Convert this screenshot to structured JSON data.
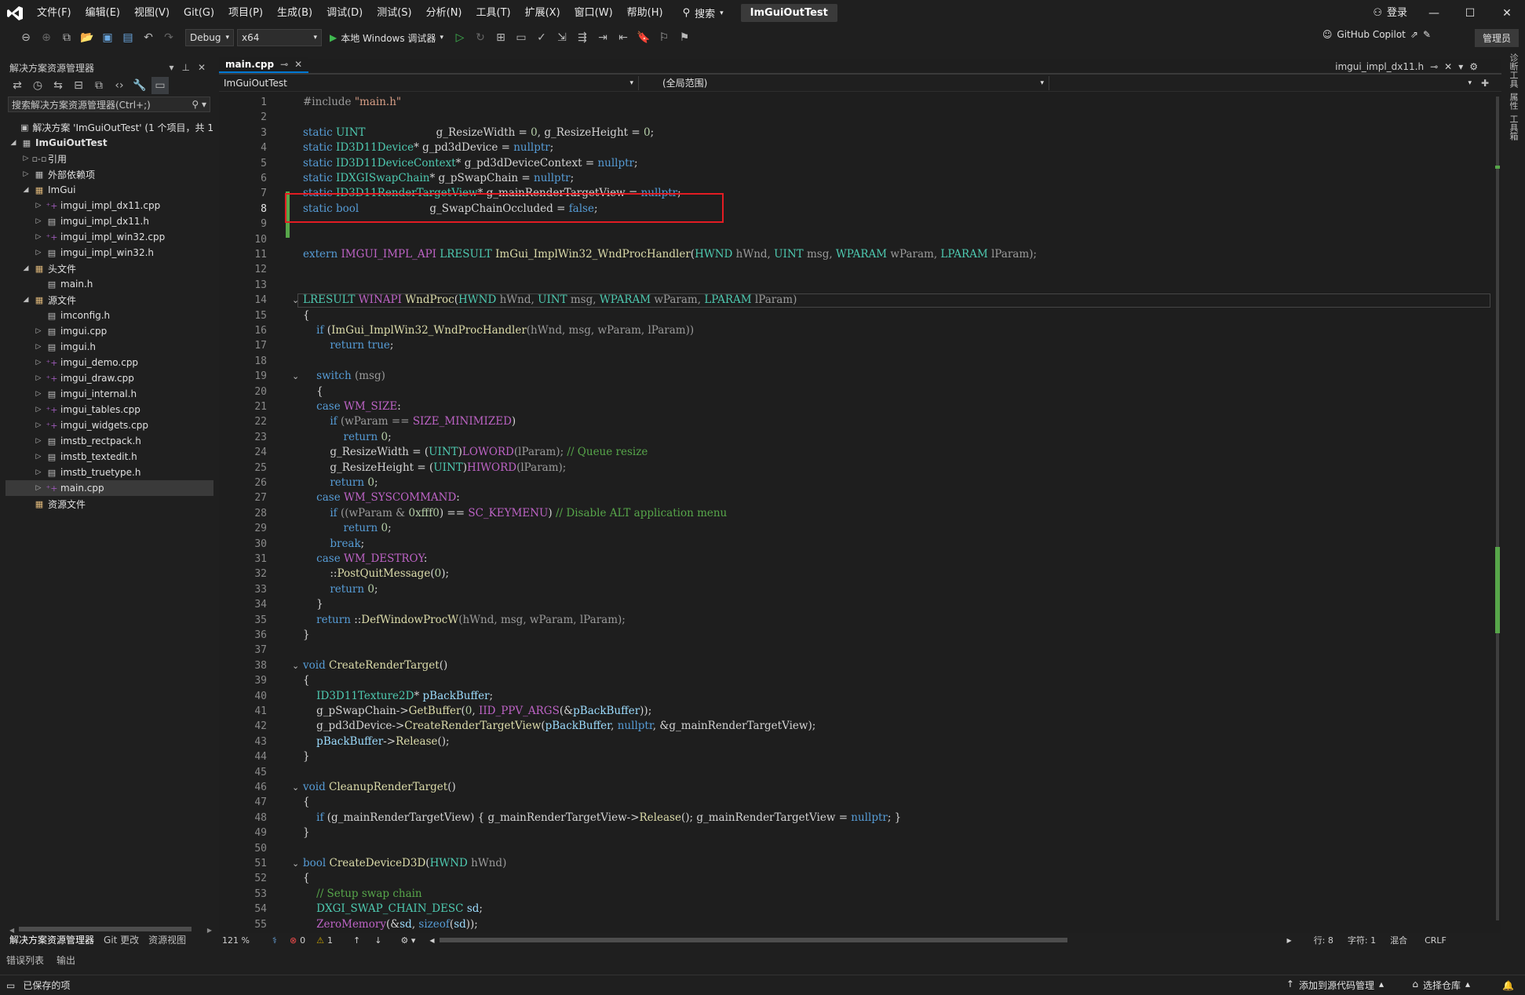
{
  "menubar": {
    "items": [
      "文件(F)",
      "编辑(E)",
      "视图(V)",
      "Git(G)",
      "项目(P)",
      "生成(B)",
      "调试(D)",
      "测试(S)",
      "分析(N)",
      "工具(T)",
      "扩展(X)",
      "窗口(W)",
      "帮助(H)"
    ],
    "search": "搜索",
    "solution_title": "ImGuiOutTest",
    "login": "登录"
  },
  "toolbar": {
    "config": "Debug",
    "platform": "x64",
    "run_label": "本地 Windows 调试器",
    "copilot": "GitHub Copilot",
    "admin": "管理员"
  },
  "solution_explorer": {
    "title": "解决方案资源管理器",
    "search_placeholder": "搜索解决方案资源管理器(Ctrl+;)",
    "tree": [
      {
        "label": "解决方案 'ImGuiOutTest' (1 个项目，共 1",
        "indent": 0,
        "icon": "solution-icon",
        "twisty": ""
      },
      {
        "label": "ImGuiOutTest",
        "indent": 0,
        "icon": "project-icon",
        "twisty": "◢",
        "bold": true
      },
      {
        "label": "引用",
        "indent": 1,
        "icon": "reference-icon",
        "twisty": "▷"
      },
      {
        "label": "外部依赖项",
        "indent": 1,
        "icon": "dependency-icon",
        "twisty": "▷"
      },
      {
        "label": "ImGui",
        "indent": 1,
        "icon": "folder-icon",
        "twisty": "◢"
      },
      {
        "label": "imgui_impl_dx11.cpp",
        "indent": 2,
        "icon": "cpp-file-icon",
        "twisty": "▷"
      },
      {
        "label": "imgui_impl_dx11.h",
        "indent": 2,
        "icon": "header-file-icon",
        "twisty": "▷"
      },
      {
        "label": "imgui_impl_win32.cpp",
        "indent": 2,
        "icon": "cpp-file-icon",
        "twisty": "▷"
      },
      {
        "label": "imgui_impl_win32.h",
        "indent": 2,
        "icon": "header-file-icon",
        "twisty": "▷"
      },
      {
        "label": "头文件",
        "indent": 1,
        "icon": "folder-icon",
        "twisty": "◢"
      },
      {
        "label": "main.h",
        "indent": 2,
        "icon": "header-file-icon",
        "twisty": ""
      },
      {
        "label": "源文件",
        "indent": 1,
        "icon": "folder-icon",
        "twisty": "◢"
      },
      {
        "label": "imconfig.h",
        "indent": 2,
        "icon": "header-file-icon",
        "twisty": ""
      },
      {
        "label": "imgui.cpp",
        "indent": 2,
        "icon": "header-file-icon",
        "twisty": "▷"
      },
      {
        "label": "imgui.h",
        "indent": 2,
        "icon": "header-file-icon",
        "twisty": "▷"
      },
      {
        "label": "imgui_demo.cpp",
        "indent": 2,
        "icon": "cpp-file-icon",
        "twisty": "▷"
      },
      {
        "label": "imgui_draw.cpp",
        "indent": 2,
        "icon": "cpp-file-icon",
        "twisty": "▷"
      },
      {
        "label": "imgui_internal.h",
        "indent": 2,
        "icon": "header-file-icon",
        "twisty": "▷"
      },
      {
        "label": "imgui_tables.cpp",
        "indent": 2,
        "icon": "cpp-file-icon",
        "twisty": "▷"
      },
      {
        "label": "imgui_widgets.cpp",
        "indent": 2,
        "icon": "cpp-file-icon",
        "twisty": "▷"
      },
      {
        "label": "imstb_rectpack.h",
        "indent": 2,
        "icon": "header-file-icon",
        "twisty": "▷"
      },
      {
        "label": "imstb_textedit.h",
        "indent": 2,
        "icon": "header-file-icon",
        "twisty": "▷"
      },
      {
        "label": "imstb_truetype.h",
        "indent": 2,
        "icon": "header-file-icon",
        "twisty": "▷"
      },
      {
        "label": "main.cpp",
        "indent": 2,
        "icon": "cpp-file-icon",
        "twisty": "▷",
        "selected": true
      },
      {
        "label": "资源文件",
        "indent": 1,
        "icon": "folder-icon",
        "twisty": ""
      }
    ],
    "bottom_tabs": [
      "解决方案资源管理器",
      "Git 更改",
      "资源视图"
    ]
  },
  "bottom_panel_tabs": [
    "错误列表",
    "输出"
  ],
  "editor": {
    "active_tab": "main.cpp",
    "right_tab": "imgui_impl_dx11.h",
    "nav_project": "ImGuiOutTest",
    "nav_scope": "(全局范围)",
    "zoom": "121 %",
    "errors": "0",
    "warnings": "1",
    "position_line": "行: 8",
    "position_char": "字符: 1",
    "indent_mode": "混合",
    "line_ending": "CRLF"
  },
  "code_lines": [
    [
      {
        "t": "#include ",
        "c": "pr"
      },
      {
        "t": "\"main.h\"",
        "c": "st"
      }
    ],
    [],
    [
      {
        "t": "static ",
        "c": "kw"
      },
      {
        "t": "UINT",
        "c": "ty"
      },
      {
        "t": "                     g_ResizeWidth = ",
        "c": "pl"
      },
      {
        "t": "0",
        "c": "nm"
      },
      {
        "t": ", g_ResizeHeight = ",
        "c": "pl"
      },
      {
        "t": "0",
        "c": "nm"
      },
      {
        "t": ";",
        "c": "pl"
      }
    ],
    [
      {
        "t": "static ",
        "c": "kw"
      },
      {
        "t": "ID3D11Device",
        "c": "ty"
      },
      {
        "t": "* g_pd3dDevice = ",
        "c": "pl"
      },
      {
        "t": "nullptr",
        "c": "kw"
      },
      {
        "t": ";",
        "c": "pl"
      }
    ],
    [
      {
        "t": "static ",
        "c": "kw"
      },
      {
        "t": "ID3D11DeviceContext",
        "c": "ty"
      },
      {
        "t": "* g_pd3dDeviceContext = ",
        "c": "pl"
      },
      {
        "t": "nullptr",
        "c": "kw"
      },
      {
        "t": ";",
        "c": "pl"
      }
    ],
    [
      {
        "t": "static ",
        "c": "kw"
      },
      {
        "t": "IDXGISwapChain",
        "c": "ty"
      },
      {
        "t": "* g_pSwapChain = ",
        "c": "pl"
      },
      {
        "t": "nullptr",
        "c": "kw"
      },
      {
        "t": ";",
        "c": "pl"
      }
    ],
    [
      {
        "t": "static ",
        "c": "kw"
      },
      {
        "t": "ID3D11RenderTargetView",
        "c": "ty"
      },
      {
        "t": "* g_mainRenderTargetView = ",
        "c": "pl"
      },
      {
        "t": "nullptr",
        "c": "kw"
      },
      {
        "t": ";",
        "c": "pl"
      }
    ],
    [
      {
        "t": "static ",
        "c": "kw"
      },
      {
        "t": "bool",
        "c": "kw"
      },
      {
        "t": "                     g_SwapChainOccluded = ",
        "c": "pl"
      },
      {
        "t": "false",
        "c": "kw"
      },
      {
        "t": ";",
        "c": "pl"
      }
    ],
    [],
    [],
    [
      {
        "t": "extern ",
        "c": "kw"
      },
      {
        "t": "IMGUI_IMPL_API ",
        "c": "mc"
      },
      {
        "t": "LRESULT ",
        "c": "ty"
      },
      {
        "t": "ImGui_ImplWin32_WndProcHandler",
        "c": "fn"
      },
      {
        "t": "(",
        "c": "pl"
      },
      {
        "t": "HWND",
        "c": "ty"
      },
      {
        "t": " hWnd, ",
        "c": "pr"
      },
      {
        "t": "UINT",
        "c": "ty"
      },
      {
        "t": " msg, ",
        "c": "pr"
      },
      {
        "t": "WPARAM",
        "c": "ty"
      },
      {
        "t": " wParam, ",
        "c": "pr"
      },
      {
        "t": "LPARAM",
        "c": "ty"
      },
      {
        "t": " lParam);",
        "c": "pr"
      }
    ],
    [],
    [],
    [
      {
        "t": "LRESULT ",
        "c": "ty"
      },
      {
        "t": "WINAPI ",
        "c": "mc"
      },
      {
        "t": "WndProc",
        "c": "fn"
      },
      {
        "t": "(",
        "c": "pl"
      },
      {
        "t": "HWND",
        "c": "ty"
      },
      {
        "t": " hWnd, ",
        "c": "pr"
      },
      {
        "t": "UINT",
        "c": "ty"
      },
      {
        "t": " msg, ",
        "c": "pr"
      },
      {
        "t": "WPARAM",
        "c": "ty"
      },
      {
        "t": " wParam, ",
        "c": "pr"
      },
      {
        "t": "LPARAM",
        "c": "ty"
      },
      {
        "t": " lParam)",
        "c": "pr"
      }
    ],
    [
      {
        "t": "{",
        "c": "pl"
      }
    ],
    [
      {
        "t": "    ",
        "c": "pl"
      },
      {
        "t": "if ",
        "c": "kw"
      },
      {
        "t": "(",
        "c": "pl"
      },
      {
        "t": "ImGui_ImplWin32_WndProcHandler",
        "c": "fn"
      },
      {
        "t": "(hWnd, msg, wParam, lParam))",
        "c": "pr"
      }
    ],
    [
      {
        "t": "        ",
        "c": "pl"
      },
      {
        "t": "return ",
        "c": "kw"
      },
      {
        "t": "true",
        "c": "kw"
      },
      {
        "t": ";",
        "c": "pl"
      }
    ],
    [],
    [
      {
        "t": "    ",
        "c": "pl"
      },
      {
        "t": "switch ",
        "c": "kw"
      },
      {
        "t": "(msg)",
        "c": "pr"
      }
    ],
    [
      {
        "t": "    {",
        "c": "pl"
      }
    ],
    [
      {
        "t": "    ",
        "c": "pl"
      },
      {
        "t": "case ",
        "c": "kw"
      },
      {
        "t": "WM_SIZE",
        "c": "mc"
      },
      {
        "t": ":",
        "c": "pl"
      }
    ],
    [
      {
        "t": "        ",
        "c": "pl"
      },
      {
        "t": "if ",
        "c": "kw"
      },
      {
        "t": "(wParam == ",
        "c": "pr"
      },
      {
        "t": "SIZE_MINIMIZED",
        "c": "mc"
      },
      {
        "t": ")",
        "c": "pl"
      }
    ],
    [
      {
        "t": "            ",
        "c": "pl"
      },
      {
        "t": "return ",
        "c": "kw"
      },
      {
        "t": "0",
        "c": "nm"
      },
      {
        "t": ";",
        "c": "pl"
      }
    ],
    [
      {
        "t": "        g_ResizeWidth = (",
        "c": "pl"
      },
      {
        "t": "UINT",
        "c": "ty"
      },
      {
        "t": ")",
        "c": "pl"
      },
      {
        "t": "LOWORD",
        "c": "mc"
      },
      {
        "t": "(lParam); ",
        "c": "pr"
      },
      {
        "t": "// Queue resize",
        "c": "cm"
      }
    ],
    [
      {
        "t": "        g_ResizeHeight = (",
        "c": "pl"
      },
      {
        "t": "UINT",
        "c": "ty"
      },
      {
        "t": ")",
        "c": "pl"
      },
      {
        "t": "HIWORD",
        "c": "mc"
      },
      {
        "t": "(lParam);",
        "c": "pr"
      }
    ],
    [
      {
        "t": "        ",
        "c": "pl"
      },
      {
        "t": "return ",
        "c": "kw"
      },
      {
        "t": "0",
        "c": "nm"
      },
      {
        "t": ";",
        "c": "pl"
      }
    ],
    [
      {
        "t": "    ",
        "c": "pl"
      },
      {
        "t": "case ",
        "c": "kw"
      },
      {
        "t": "WM_SYSCOMMAND",
        "c": "mc"
      },
      {
        "t": ":",
        "c": "pl"
      }
    ],
    [
      {
        "t": "        ",
        "c": "pl"
      },
      {
        "t": "if ",
        "c": "kw"
      },
      {
        "t": "((wParam & ",
        "c": "pr"
      },
      {
        "t": "0xfff0",
        "c": "nm"
      },
      {
        "t": ") == ",
        "c": "pl"
      },
      {
        "t": "SC_KEYMENU",
        "c": "mc"
      },
      {
        "t": ") ",
        "c": "pl"
      },
      {
        "t": "// Disable ALT application menu",
        "c": "cm"
      }
    ],
    [
      {
        "t": "            ",
        "c": "pl"
      },
      {
        "t": "return ",
        "c": "kw"
      },
      {
        "t": "0",
        "c": "nm"
      },
      {
        "t": ";",
        "c": "pl"
      }
    ],
    [
      {
        "t": "        ",
        "c": "pl"
      },
      {
        "t": "break",
        "c": "kw"
      },
      {
        "t": ";",
        "c": "pl"
      }
    ],
    [
      {
        "t": "    ",
        "c": "pl"
      },
      {
        "t": "case ",
        "c": "kw"
      },
      {
        "t": "WM_DESTROY",
        "c": "mc"
      },
      {
        "t": ":",
        "c": "pl"
      }
    ],
    [
      {
        "t": "        ::",
        "c": "pl"
      },
      {
        "t": "PostQuitMessage",
        "c": "fn"
      },
      {
        "t": "(",
        "c": "pl"
      },
      {
        "t": "0",
        "c": "nm"
      },
      {
        "t": ");",
        "c": "pl"
      }
    ],
    [
      {
        "t": "        ",
        "c": "pl"
      },
      {
        "t": "return ",
        "c": "kw"
      },
      {
        "t": "0",
        "c": "nm"
      },
      {
        "t": ";",
        "c": "pl"
      }
    ],
    [
      {
        "t": "    }",
        "c": "pl"
      }
    ],
    [
      {
        "t": "    ",
        "c": "pl"
      },
      {
        "t": "return ",
        "c": "kw"
      },
      {
        "t": "::",
        "c": "pl"
      },
      {
        "t": "DefWindowProcW",
        "c": "fn"
      },
      {
        "t": "(hWnd, msg, wParam, lParam);",
        "c": "pr"
      }
    ],
    [
      {
        "t": "}",
        "c": "pl"
      }
    ],
    [],
    [
      {
        "t": "void ",
        "c": "kw"
      },
      {
        "t": "CreateRenderTarget",
        "c": "fn"
      },
      {
        "t": "()",
        "c": "pl"
      }
    ],
    [
      {
        "t": "{",
        "c": "pl"
      }
    ],
    [
      {
        "t": "    ",
        "c": "pl"
      },
      {
        "t": "ID3D11Texture2D",
        "c": "ty"
      },
      {
        "t": "* ",
        "c": "pl"
      },
      {
        "t": "pBackBuffer",
        "c": "var"
      },
      {
        "t": ";",
        "c": "pl"
      }
    ],
    [
      {
        "t": "    g_pSwapChain->",
        "c": "pl"
      },
      {
        "t": "GetBuffer",
        "c": "fn"
      },
      {
        "t": "(",
        "c": "pl"
      },
      {
        "t": "0",
        "c": "nm"
      },
      {
        "t": ", ",
        "c": "pl"
      },
      {
        "t": "IID_PPV_ARGS",
        "c": "mc"
      },
      {
        "t": "(&",
        "c": "pl"
      },
      {
        "t": "pBackBuffer",
        "c": "var"
      },
      {
        "t": "));",
        "c": "pl"
      }
    ],
    [
      {
        "t": "    g_pd3dDevice->",
        "c": "pl"
      },
      {
        "t": "CreateRenderTargetView",
        "c": "fn"
      },
      {
        "t": "(",
        "c": "pl"
      },
      {
        "t": "pBackBuffer",
        "c": "var"
      },
      {
        "t": ", ",
        "c": "pl"
      },
      {
        "t": "nullptr",
        "c": "kw"
      },
      {
        "t": ", &g_mainRenderTargetView);",
        "c": "pl"
      }
    ],
    [
      {
        "t": "    ",
        "c": "pl"
      },
      {
        "t": "pBackBuffer",
        "c": "var"
      },
      {
        "t": "->",
        "c": "pl"
      },
      {
        "t": "Release",
        "c": "fn"
      },
      {
        "t": "();",
        "c": "pl"
      }
    ],
    [
      {
        "t": "}",
        "c": "pl"
      }
    ],
    [],
    [
      {
        "t": "void ",
        "c": "kw"
      },
      {
        "t": "CleanupRenderTarget",
        "c": "fn"
      },
      {
        "t": "()",
        "c": "pl"
      }
    ],
    [
      {
        "t": "{",
        "c": "pl"
      }
    ],
    [
      {
        "t": "    ",
        "c": "pl"
      },
      {
        "t": "if ",
        "c": "kw"
      },
      {
        "t": "(g_mainRenderTargetView) { g_mainRenderTargetView->",
        "c": "pl"
      },
      {
        "t": "Release",
        "c": "fn"
      },
      {
        "t": "(); g_mainRenderTargetView = ",
        "c": "pl"
      },
      {
        "t": "nullptr",
        "c": "kw"
      },
      {
        "t": "; }",
        "c": "pl"
      }
    ],
    [
      {
        "t": "}",
        "c": "pl"
      }
    ],
    [],
    [
      {
        "t": "bool ",
        "c": "kw"
      },
      {
        "t": "CreateDeviceD3D",
        "c": "fn"
      },
      {
        "t": "(",
        "c": "pl"
      },
      {
        "t": "HWND",
        "c": "ty"
      },
      {
        "t": " hWnd)",
        "c": "pr"
      }
    ],
    [
      {
        "t": "{",
        "c": "pl"
      }
    ],
    [
      {
        "t": "    ",
        "c": "pl"
      },
      {
        "t": "// Setup swap chain",
        "c": "cm"
      }
    ],
    [
      {
        "t": "    ",
        "c": "pl"
      },
      {
        "t": "DXGI_SWAP_CHAIN_DESC",
        "c": "ty"
      },
      {
        "t": " ",
        "c": "pl"
      },
      {
        "t": "sd",
        "c": "var"
      },
      {
        "t": ";",
        "c": "pl"
      }
    ],
    [
      {
        "t": "    ",
        "c": "pl"
      },
      {
        "t": "ZeroMemory",
        "c": "mc"
      },
      {
        "t": "(&",
        "c": "pl"
      },
      {
        "t": "sd",
        "c": "var"
      },
      {
        "t": ", ",
        "c": "pl"
      },
      {
        "t": "sizeof",
        "c": "kw"
      },
      {
        "t": "(",
        "c": "pl"
      },
      {
        "t": "sd",
        "c": "var"
      },
      {
        "t": "));",
        "c": "pl"
      }
    ]
  ],
  "fold_lines": [
    14,
    19,
    38,
    46,
    51
  ],
  "current_line": 8,
  "status": {
    "saved": "已保存的项",
    "source_control": "添加到源代码管理",
    "repo": "选择仓库"
  },
  "right_strip": [
    "诊断工具",
    "属性",
    "工具箱"
  ],
  "colors": {
    "accent": "#0078d4",
    "highlight_box": "#e31c23",
    "change_bar": "#57a64a"
  }
}
